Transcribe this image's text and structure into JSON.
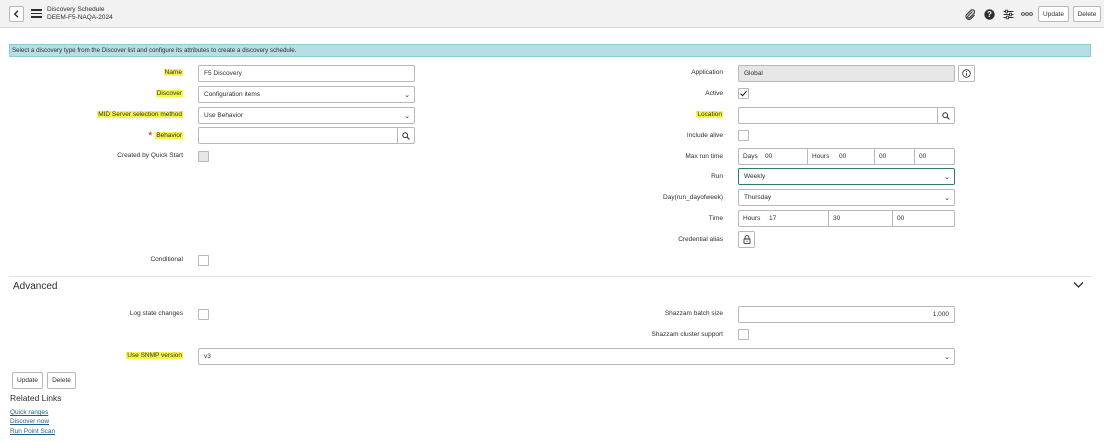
{
  "header": {
    "title": "Discovery Schedule",
    "subtitle": "DEEM-F5-NAQA-2024",
    "update_label": "Update",
    "delete_label": "Delete"
  },
  "info_message": "Select a discovery type from the Discover list and configure its attributes to create a discovery schedule.",
  "form": {
    "name": {
      "label": "Name",
      "value": "F5 Discovery"
    },
    "discover": {
      "label": "Discover",
      "value": "Configuration items"
    },
    "mid_server": {
      "label": "MID Server selection method",
      "value": "Use Behavior"
    },
    "behavior": {
      "label": "Behavior",
      "value": ""
    },
    "created_by_quick_start": {
      "label": "Created by Quick Start",
      "checked": false
    },
    "conditional": {
      "label": "Conditional",
      "checked": false
    },
    "application": {
      "label": "Application",
      "value": "Global"
    },
    "active": {
      "label": "Active",
      "checked": true
    },
    "location": {
      "label": "Location",
      "value": ""
    },
    "include_alive": {
      "label": "Include alive",
      "checked": false
    },
    "max_run_time": {
      "label": "Max run time",
      "days_label": "Days",
      "days": "00",
      "hours_label": "Hours",
      "hours": "00",
      "minutes": "00",
      "seconds": "00"
    },
    "run": {
      "label": "Run",
      "value": "Weekly"
    },
    "day": {
      "label": "Day(run_dayofweek)",
      "value": "Thursday"
    },
    "time": {
      "label": "Time",
      "hours_label": "Hours",
      "hours": "17",
      "minutes": "30",
      "seconds": "00"
    },
    "credential_alias": {
      "label": "Credential alias"
    }
  },
  "advanced": {
    "title": "Advanced",
    "log_state_changes": {
      "label": "Log state changes",
      "checked": false
    },
    "shazzam_batch_size": {
      "label": "Shazzam batch size",
      "value": "1,000"
    },
    "shazzam_cluster_support": {
      "label": "Shazzam cluster support",
      "checked": false
    },
    "snmp_version": {
      "label": "Use SNMP version",
      "value": "v3"
    }
  },
  "buttons": {
    "update": "Update",
    "delete": "Delete"
  },
  "related_links": {
    "title": "Related Links",
    "items": [
      "Quick ranges",
      "Discover now",
      "Run Point Scan"
    ]
  },
  "colors": {
    "highlight": "#f6f54a",
    "info_bar": "#b6dfe5",
    "focus_border": "#2d7b6f",
    "required": "#e0251b",
    "link": "#1f5f8b"
  },
  "icons": [
    "back-icon",
    "menu-icon",
    "attachment-icon",
    "help-icon",
    "settings-icon",
    "more-icon",
    "search-icon",
    "info-icon",
    "lock-icon",
    "chevron-down-icon"
  ]
}
